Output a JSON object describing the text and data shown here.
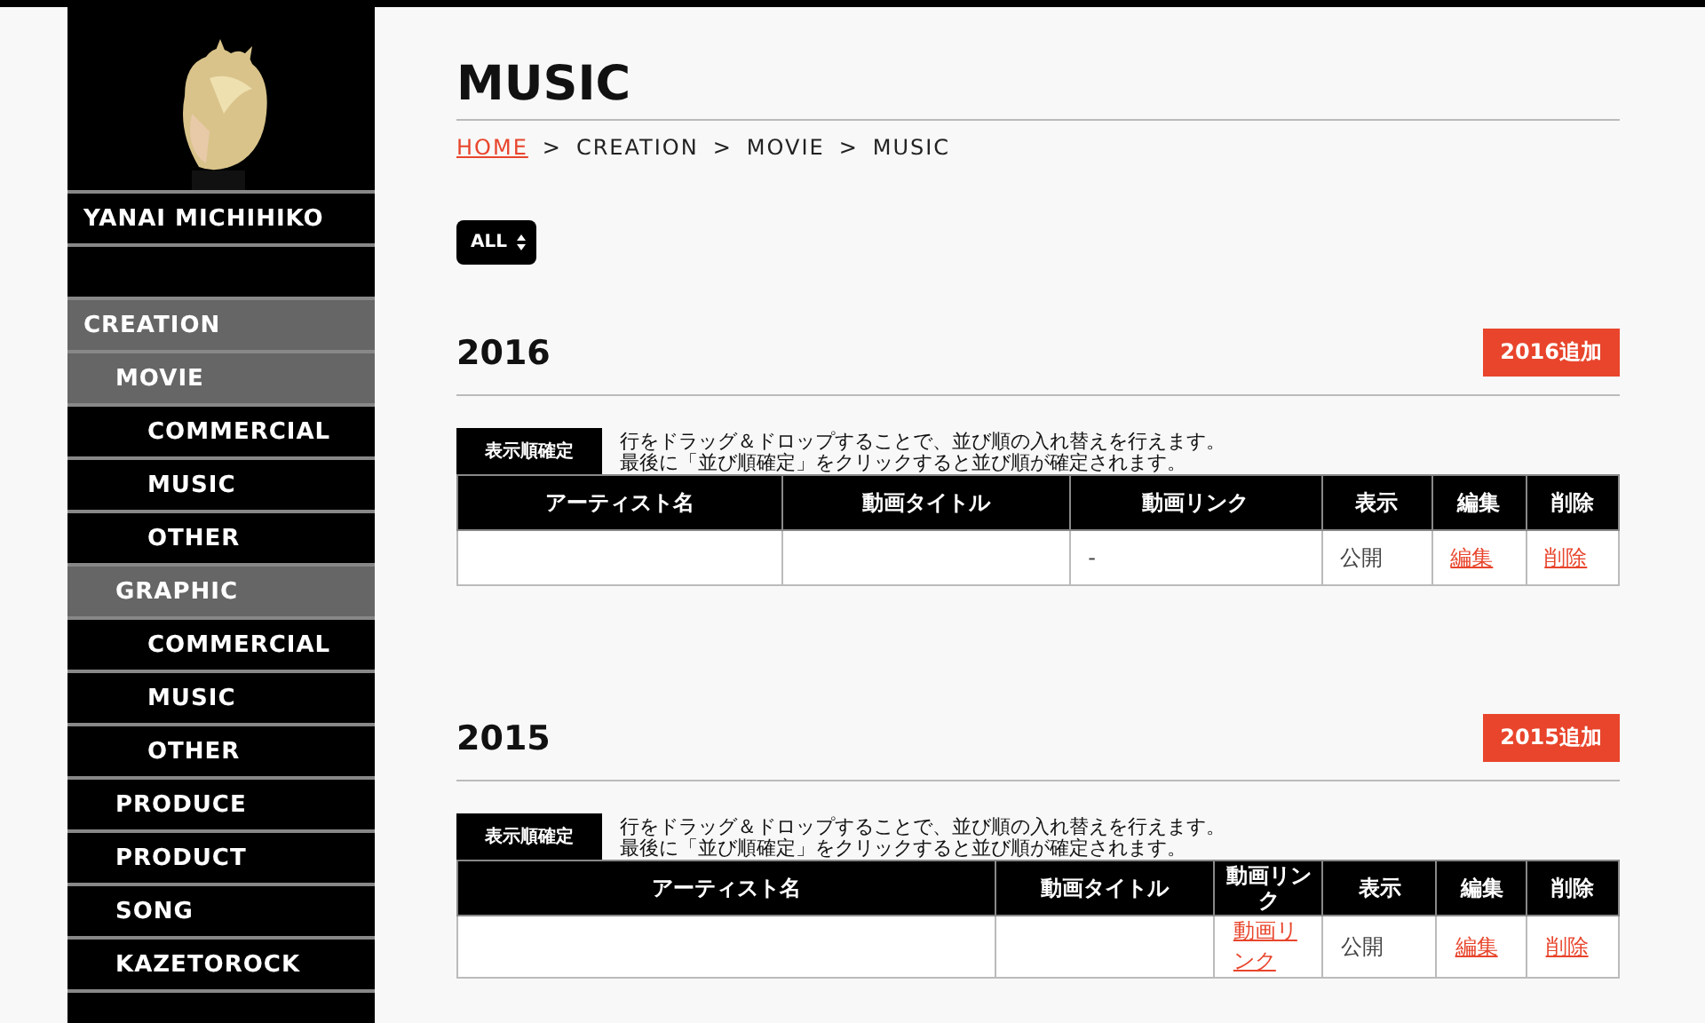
{
  "sidebar": {
    "name": "YANAI MICHIHIKO",
    "menu": [
      {
        "label": "CREATION",
        "expanded": true,
        "children": [
          {
            "label": "MOVIE",
            "expanded": true,
            "children": [
              {
                "label": "COMMERCIAL"
              },
              {
                "label": "MUSIC"
              },
              {
                "label": "OTHER"
              }
            ]
          },
          {
            "label": "GRAPHIC",
            "expanded": true,
            "children": [
              {
                "label": "COMMERCIAL"
              },
              {
                "label": "MUSIC"
              },
              {
                "label": "OTHER"
              }
            ]
          },
          {
            "label": "PRODUCE"
          },
          {
            "label": "PRODUCT"
          },
          {
            "label": "SONG"
          },
          {
            "label": "KAZETOROCK"
          }
        ]
      }
    ]
  },
  "page": {
    "title": "MUSIC",
    "breadcrumb": [
      {
        "label": "HOME",
        "link": true
      },
      {
        "label": "CREATION",
        "link": false
      },
      {
        "label": "MOVIE",
        "link": false
      },
      {
        "label": "MUSIC",
        "link": false
      }
    ],
    "separator": ">",
    "filter": {
      "value": "ALL"
    }
  },
  "sections": [
    {
      "year": "2016",
      "add_button": "2016追加",
      "confirm_button": "表示順確定",
      "instructions": [
        "行をドラッグ＆ドロップすることで、並び順の入れ替えを行えます。",
        "最後に「並び順確定」をクリックすると並び順が確定されます。"
      ],
      "columns": [
        "アーティスト名",
        "動画タイトル",
        "動画リンク",
        "表示",
        "編集",
        "削除"
      ],
      "rows": [
        [
          {
            "kind": "text",
            "text": ""
          },
          {
            "kind": "text",
            "text": ""
          },
          {
            "kind": "text",
            "text": "-"
          },
          {
            "kind": "text",
            "text": "公開"
          },
          {
            "kind": "link",
            "text": "編集"
          },
          {
            "kind": "link",
            "text": "削除"
          }
        ]
      ]
    },
    {
      "year": "2015",
      "add_button": "2015追加",
      "confirm_button": "表示順確定",
      "instructions": [
        "行をドラッグ＆ドロップすることで、並び順の入れ替えを行えます。",
        "最後に「並び順確定」をクリックすると並び順が確定されます。"
      ],
      "columns": [
        "アーティスト名",
        "動画タイトル",
        "動画リンク",
        "表示",
        "編集",
        "削除"
      ],
      "rows": [
        [
          {
            "kind": "text",
            "text": ""
          },
          {
            "kind": "text",
            "text": ""
          },
          {
            "kind": "link",
            "text": "動画リンク"
          },
          {
            "kind": "text",
            "text": "公開"
          },
          {
            "kind": "link",
            "text": "編集"
          },
          {
            "kind": "link",
            "text": "削除"
          }
        ]
      ]
    }
  ]
}
